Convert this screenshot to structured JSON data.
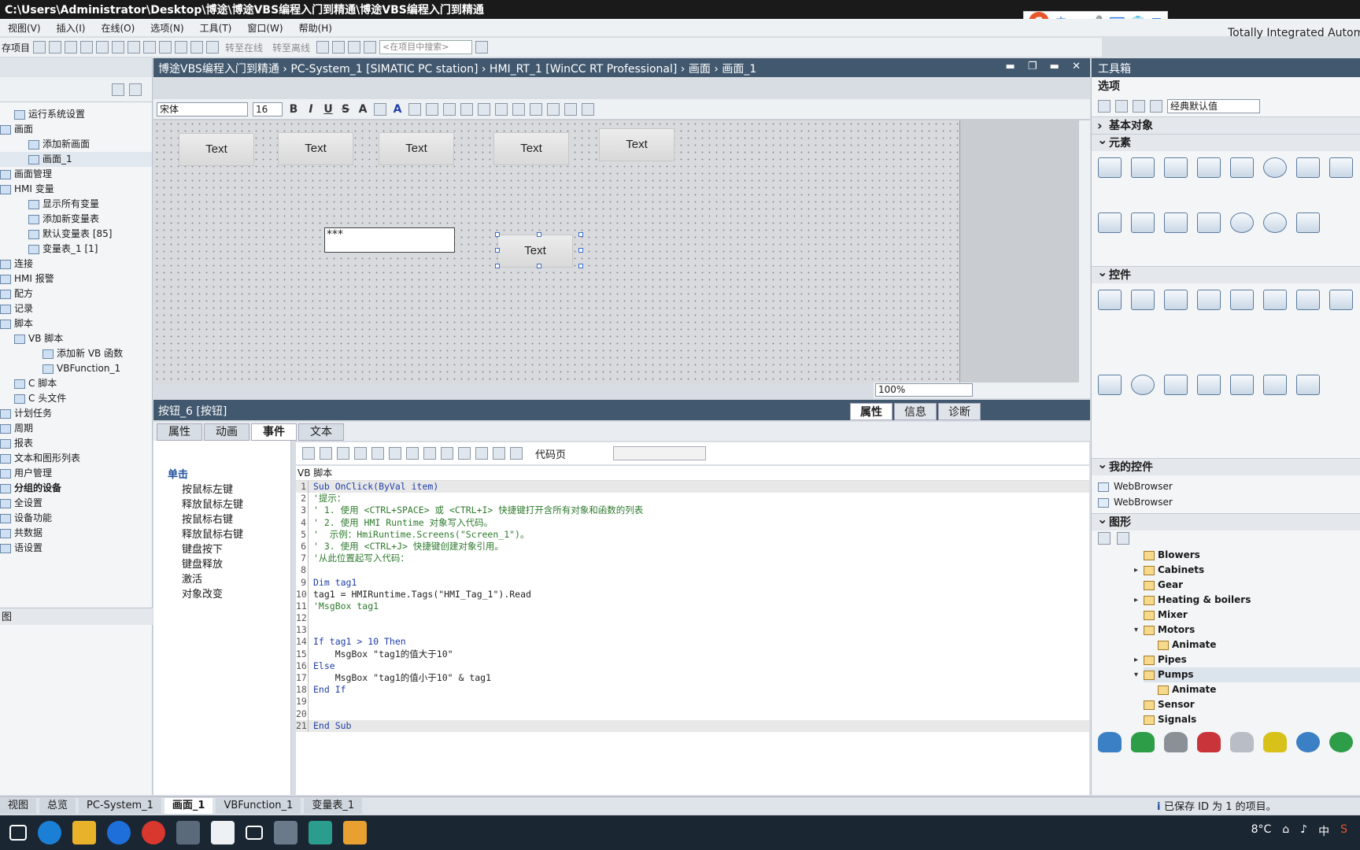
{
  "window": {
    "title": "C:\\Users\\Administrator\\Desktop\\博途\\博途VBS编程入门到精通\\博途VBS编程入门到精通",
    "brand": "Totally Integrated Automation"
  },
  "menu": [
    "视图(V)",
    "插入(I)",
    "在线(O)",
    "选项(N)",
    "工具(T)",
    "窗口(W)",
    "帮助(H)"
  ],
  "menu_prefix": "存项目",
  "toolbar": {
    "go_online": "转至在线",
    "go_offline": "转至离线",
    "search_placeholder": "<在项目中搜索>"
  },
  "ime": {
    "lang": "中",
    "mode": "•,"
  },
  "project_tree": {
    "items": [
      {
        "label": "运行系统设置",
        "indent": 1
      },
      {
        "label": "画面",
        "indent": 0
      },
      {
        "label": "添加新画面",
        "indent": 2
      },
      {
        "label": "画面_1",
        "indent": 2,
        "selected": true
      },
      {
        "label": "画面管理",
        "indent": 0
      },
      {
        "label": "HMI 变量",
        "indent": 0
      },
      {
        "label": "显示所有变量",
        "indent": 2
      },
      {
        "label": "添加新变量表",
        "indent": 2
      },
      {
        "label": "默认变量表 [85]",
        "indent": 2
      },
      {
        "label": "变量表_1 [1]",
        "indent": 2
      },
      {
        "label": "连接",
        "indent": 0
      },
      {
        "label": "HMI 报警",
        "indent": 0
      },
      {
        "label": "配方",
        "indent": 0
      },
      {
        "label": "记录",
        "indent": 0
      },
      {
        "label": "脚本",
        "indent": 0
      },
      {
        "label": "VB 脚本",
        "indent": 1
      },
      {
        "label": "添加新 VB 函数",
        "indent": 3
      },
      {
        "label": "VBFunction_1",
        "indent": 3
      },
      {
        "label": "C 脚本",
        "indent": 1
      },
      {
        "label": "C 头文件",
        "indent": 1
      },
      {
        "label": "计划任务",
        "indent": 0
      },
      {
        "label": "周期",
        "indent": 0
      },
      {
        "label": "报表",
        "indent": 0
      },
      {
        "label": "文本和图形列表",
        "indent": 0
      },
      {
        "label": "用户管理",
        "indent": 0
      },
      {
        "label": "分组的设备",
        "indent": 0,
        "bold": true
      },
      {
        "label": "全设置",
        "indent": 0
      },
      {
        "label": "设备功能",
        "indent": 0
      },
      {
        "label": "共数据",
        "indent": 0
      },
      {
        "label": "语设置",
        "indent": 0
      }
    ],
    "bottom_panel_title": "图"
  },
  "editor": {
    "breadcrumb": "博途VBS编程入门到精通  ›  PC-System_1 [SIMATIC PC station]  ›  HMI_RT_1 [WinCC RT Professional]  ›  画面  ›  画面_1",
    "font": "宋体",
    "font_size": "16",
    "zoom": "100%",
    "buttons": [
      "Text",
      "Text",
      "Text",
      "Text",
      "Text",
      "Text"
    ],
    "io_field": "***"
  },
  "properties": {
    "title": "按钮_6 [按钮]",
    "right_tabs": [
      "属性",
      "信息",
      "诊断"
    ],
    "sub_tabs": [
      "属性",
      "动画",
      "事件",
      "文本"
    ],
    "events": [
      "单击",
      "按鼠标左键",
      "释放鼠标左键",
      "按鼠标右键",
      "释放鼠标右键",
      "键盘按下",
      "键盘释放",
      "激活",
      "对象改变"
    ],
    "code_page_label": "代码页",
    "vb_label": "VB 脚本",
    "code_lines": [
      "Sub OnClick(ByVal item)",
      "'提示：",
      "' 1. 使用 <CTRL+SPACE> 或 <CTRL+I> 快捷键打开含所有对象和函数的列表",
      "' 2. 使用 HMI Runtime 对象写入代码。",
      "'  示例：HmiRuntime.Screens(\"Screen_1\")。",
      "' 3. 使用 <CTRL+J> 快捷键创建对象引用。",
      "'从此位置起写入代码：",
      "",
      "Dim tag1",
      "tag1 = HMIRuntime.Tags(\"HMI_Tag_1\").Read",
      "'MsgBox tag1",
      "",
      "",
      "If tag1 > 10 Then",
      "    MsgBox \"tag1的值大于10\"",
      "Else",
      "    MsgBox \"tag1的值小于10\" & tag1",
      "End If",
      "",
      "",
      "End Sub"
    ]
  },
  "toolbox": {
    "title": "工具箱",
    "options_label": "选项",
    "style_select": "经典默认值",
    "sections": {
      "basic": "基本对象",
      "elements": "元素",
      "controls": "控件",
      "my_controls": "我的控件",
      "graphics": "图形"
    },
    "my_controls": [
      "WebBrowser",
      "WebBrowser"
    ],
    "graphics": [
      {
        "label": "Blowers",
        "level": 0,
        "arrow": ""
      },
      {
        "label": "Cabinets",
        "level": 0,
        "arrow": "▸"
      },
      {
        "label": "Gear",
        "level": 0,
        "arrow": ""
      },
      {
        "label": "Heating & boilers",
        "level": 0,
        "arrow": "▸"
      },
      {
        "label": "Mixer",
        "level": 0,
        "arrow": ""
      },
      {
        "label": "Motors",
        "level": 0,
        "arrow": "▾"
      },
      {
        "label": "Animate",
        "level": 1,
        "arrow": ""
      },
      {
        "label": "Pipes",
        "level": 0,
        "arrow": "▸"
      },
      {
        "label": "Pumps",
        "level": 0,
        "arrow": "▾",
        "selected": true
      },
      {
        "label": "Animate",
        "level": 1,
        "arrow": ""
      },
      {
        "label": "Sensor",
        "level": 0,
        "arrow": ""
      },
      {
        "label": "Signals",
        "level": 0,
        "arrow": ""
      }
    ]
  },
  "bottom_tabs": [
    "视图",
    "总览",
    "PC-System_1",
    "画面_1",
    "VBFunction_1",
    "变量表_1"
  ],
  "status": "已保存 ID 为 1 的项目。",
  "tray": {
    "temp": "8°C",
    "lang": "中"
  },
  "colors": {
    "title_bar": "#1a1a1a",
    "panel_header": "#42586f",
    "accent": "#1f4f9e",
    "comment": "#2d7a2d",
    "keyword": "#1f3ea8"
  }
}
